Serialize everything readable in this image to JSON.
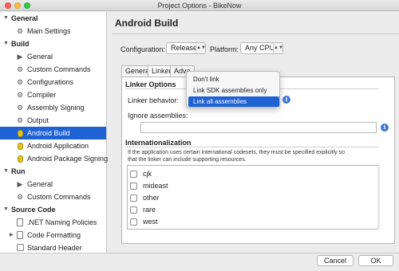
{
  "window": {
    "title": "Project Options - BikeNow"
  },
  "sidebar": {
    "sections": [
      {
        "label": "General",
        "items": [
          {
            "label": "Main Settings",
            "icon": "gear-icon"
          }
        ]
      },
      {
        "label": "Build",
        "items": [
          {
            "label": "General",
            "icon": "play-icon"
          },
          {
            "label": "Custom Commands",
            "icon": "gear-icon"
          },
          {
            "label": "Configurations",
            "icon": "gear-icon"
          },
          {
            "label": "Compiler",
            "icon": "gear-icon"
          },
          {
            "label": "Assembly Signing",
            "icon": "gear-icon"
          },
          {
            "label": "Output",
            "icon": "gear-icon"
          },
          {
            "label": "Android Build",
            "icon": "android-icon",
            "selected": true
          },
          {
            "label": "Android Application",
            "icon": "android-icon"
          },
          {
            "label": "Android Package Signing",
            "icon": "android-icon"
          }
        ]
      },
      {
        "label": "Run",
        "items": [
          {
            "label": "General",
            "icon": "play-icon"
          },
          {
            "label": "Custom Commands",
            "icon": "gear-icon"
          }
        ]
      },
      {
        "label": "Source Code",
        "items": [
          {
            "label": ".NET Naming Policies",
            "icon": "document-icon"
          },
          {
            "label": "Code Formatting",
            "icon": "document-icon"
          },
          {
            "label": "Standard Header",
            "icon": "box-icon"
          }
        ]
      }
    ]
  },
  "main": {
    "title": "Android Build",
    "configuration_label": "Configuration:",
    "configuration_value": "Release",
    "platform_label": "Platform:",
    "platform_value": "Any CPU",
    "tabs": [
      "General",
      "Linker",
      "Adva"
    ],
    "linker_options_heading": "Linker Options",
    "linker_behavior_label": "Linker behavior:",
    "ignore_assemblies_label": "Ignore assemblies:",
    "ignore_assemblies_value": "",
    "internationalization_heading": "Internationalization",
    "internationalization_desc": "If the application uses certain international codesets, they must be specified explicitly so that the linker can include supporting resources.",
    "codesets": [
      "cjk",
      "mideast",
      "other",
      "rare",
      "west"
    ]
  },
  "linker_menu": {
    "options": [
      "Don't link",
      "Link SDK assemblies only",
      "Link all assemblies"
    ],
    "selected_index": 2
  },
  "buttons": {
    "cancel": "Cancel",
    "ok": "OK"
  },
  "colors": {
    "selection": "#1f62d4",
    "info": "#3c79d6"
  }
}
